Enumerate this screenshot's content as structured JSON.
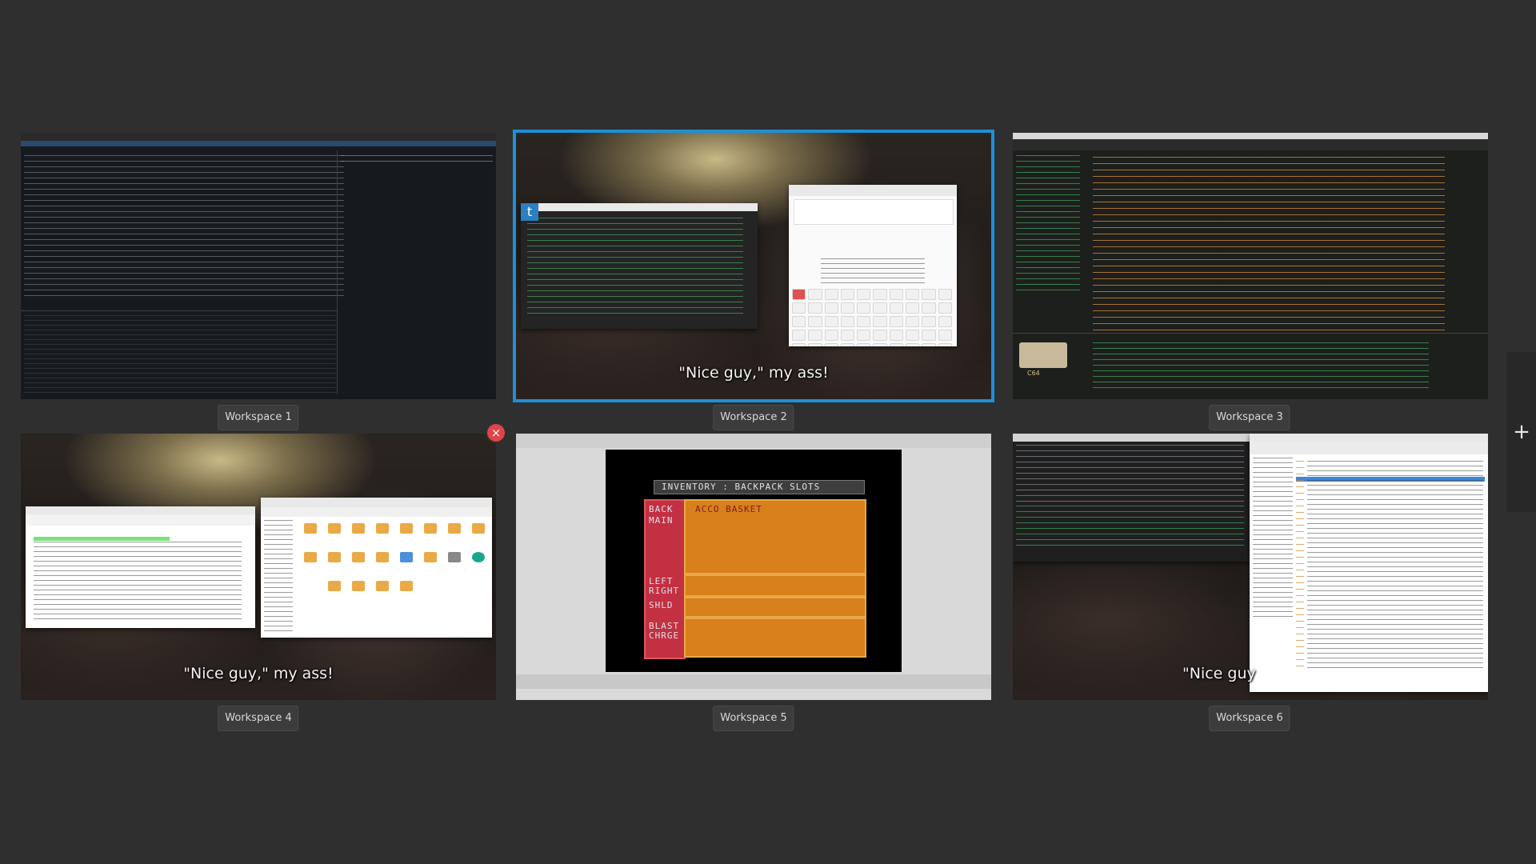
{
  "overview": {
    "add_workspace_symbol": "+",
    "close_symbol": "×"
  },
  "workspaces": [
    {
      "label": "Workspace 1",
      "active": false
    },
    {
      "label": "Workspace 2",
      "active": true,
      "subtitle": "\"Nice guy,\" my ass!"
    },
    {
      "label": "Workspace 3",
      "active": false,
      "thumb_text": "C64"
    },
    {
      "label": "Workspace 4",
      "active": false,
      "subtitle": "\"Nice guy,\" my ass!"
    },
    {
      "label": "Workspace 5",
      "active": false,
      "game_title": "INVENTORY : BACKPACK SLOTS",
      "game_rows": [
        "BACK",
        "MAIN",
        "LEFT",
        "RIGHT",
        "SHLD",
        "BLAST",
        "CHRGE"
      ],
      "game_item": "ACCO BASKET"
    },
    {
      "label": "Workspace 6",
      "active": false,
      "subtitle": "\"Nice guy"
    }
  ],
  "colors": {
    "background": "#2f2f2f",
    "active_outline": "#1f8fd8",
    "close_button": "#e0444b"
  },
  "icons": [
    "close-icon",
    "plus-icon"
  ]
}
